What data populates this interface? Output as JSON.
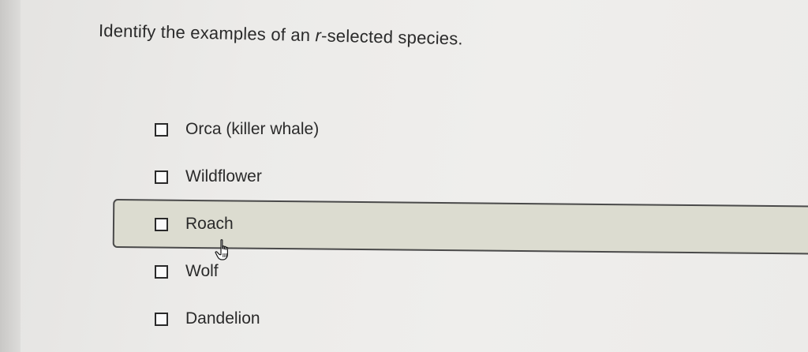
{
  "question": {
    "prefix": "Identify the examples of an ",
    "italic": "r",
    "suffix": "-selected species."
  },
  "options": [
    {
      "label": "Orca (killer whale)",
      "checked": false
    },
    {
      "label": "Wildflower",
      "checked": false
    },
    {
      "label": "Roach",
      "checked": false,
      "hovered": true
    },
    {
      "label": "Wolf",
      "checked": false
    },
    {
      "label": "Dandelion",
      "checked": false
    }
  ],
  "icons": {
    "cursor": "hand-pointer-icon",
    "checkbox": "checkbox-unchecked-icon"
  },
  "colors": {
    "background": "#ecebe9",
    "highlight": "#dcdcd0",
    "text": "#2a2a2a"
  }
}
